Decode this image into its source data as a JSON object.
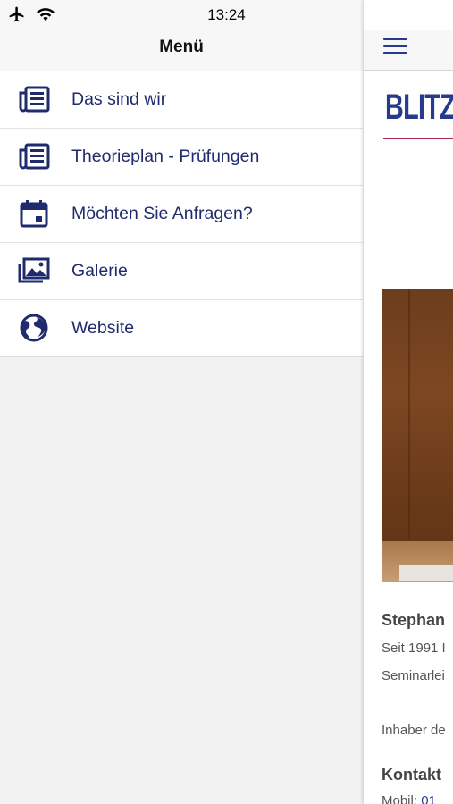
{
  "status_bar": {
    "time": "13:24"
  },
  "menu": {
    "title": "Menü",
    "items": [
      {
        "label": "Das sind wir",
        "icon": "news-icon"
      },
      {
        "label": "Theorieplan - Prüfungen",
        "icon": "news-icon"
      },
      {
        "label": "Möchten Sie Anfragen?",
        "icon": "calendar-icon"
      },
      {
        "label": "Galerie",
        "icon": "gallery-icon"
      },
      {
        "label": "Website",
        "icon": "globe-icon"
      }
    ]
  },
  "content": {
    "logo_text": "BLITZ",
    "name": "Stephan",
    "line1": "Seit 1991 I",
    "line2": "Seminarlei",
    "line3": "Inhaber de",
    "contact_heading": "Kontakt",
    "mobile_label": "Mobil:",
    "mobile_number": "01"
  },
  "colors": {
    "accent": "#1f2b6d",
    "brand": "#283a8c",
    "logo_line": "#a8264a"
  }
}
